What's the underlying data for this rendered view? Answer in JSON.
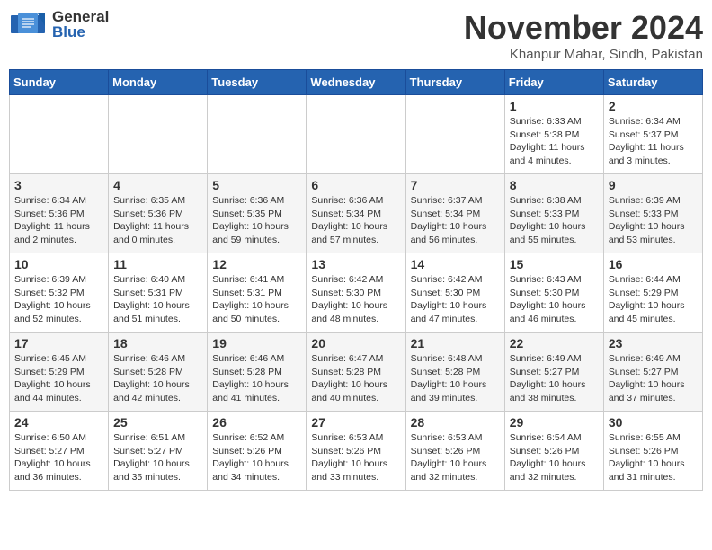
{
  "header": {
    "logo_general": "General",
    "logo_blue": "Blue",
    "month_title": "November 2024",
    "location": "Khanpur Mahar, Sindh, Pakistan"
  },
  "days_of_week": [
    "Sunday",
    "Monday",
    "Tuesday",
    "Wednesday",
    "Thursday",
    "Friday",
    "Saturday"
  ],
  "weeks": [
    [
      {
        "day": "",
        "info": ""
      },
      {
        "day": "",
        "info": ""
      },
      {
        "day": "",
        "info": ""
      },
      {
        "day": "",
        "info": ""
      },
      {
        "day": "",
        "info": ""
      },
      {
        "day": "1",
        "info": "Sunrise: 6:33 AM\nSunset: 5:38 PM\nDaylight: 11 hours and 4 minutes."
      },
      {
        "day": "2",
        "info": "Sunrise: 6:34 AM\nSunset: 5:37 PM\nDaylight: 11 hours and 3 minutes."
      }
    ],
    [
      {
        "day": "3",
        "info": "Sunrise: 6:34 AM\nSunset: 5:36 PM\nDaylight: 11 hours and 2 minutes."
      },
      {
        "day": "4",
        "info": "Sunrise: 6:35 AM\nSunset: 5:36 PM\nDaylight: 11 hours and 0 minutes."
      },
      {
        "day": "5",
        "info": "Sunrise: 6:36 AM\nSunset: 5:35 PM\nDaylight: 10 hours and 59 minutes."
      },
      {
        "day": "6",
        "info": "Sunrise: 6:36 AM\nSunset: 5:34 PM\nDaylight: 10 hours and 57 minutes."
      },
      {
        "day": "7",
        "info": "Sunrise: 6:37 AM\nSunset: 5:34 PM\nDaylight: 10 hours and 56 minutes."
      },
      {
        "day": "8",
        "info": "Sunrise: 6:38 AM\nSunset: 5:33 PM\nDaylight: 10 hours and 55 minutes."
      },
      {
        "day": "9",
        "info": "Sunrise: 6:39 AM\nSunset: 5:33 PM\nDaylight: 10 hours and 53 minutes."
      }
    ],
    [
      {
        "day": "10",
        "info": "Sunrise: 6:39 AM\nSunset: 5:32 PM\nDaylight: 10 hours and 52 minutes."
      },
      {
        "day": "11",
        "info": "Sunrise: 6:40 AM\nSunset: 5:31 PM\nDaylight: 10 hours and 51 minutes."
      },
      {
        "day": "12",
        "info": "Sunrise: 6:41 AM\nSunset: 5:31 PM\nDaylight: 10 hours and 50 minutes."
      },
      {
        "day": "13",
        "info": "Sunrise: 6:42 AM\nSunset: 5:30 PM\nDaylight: 10 hours and 48 minutes."
      },
      {
        "day": "14",
        "info": "Sunrise: 6:42 AM\nSunset: 5:30 PM\nDaylight: 10 hours and 47 minutes."
      },
      {
        "day": "15",
        "info": "Sunrise: 6:43 AM\nSunset: 5:30 PM\nDaylight: 10 hours and 46 minutes."
      },
      {
        "day": "16",
        "info": "Sunrise: 6:44 AM\nSunset: 5:29 PM\nDaylight: 10 hours and 45 minutes."
      }
    ],
    [
      {
        "day": "17",
        "info": "Sunrise: 6:45 AM\nSunset: 5:29 PM\nDaylight: 10 hours and 44 minutes."
      },
      {
        "day": "18",
        "info": "Sunrise: 6:46 AM\nSunset: 5:28 PM\nDaylight: 10 hours and 42 minutes."
      },
      {
        "day": "19",
        "info": "Sunrise: 6:46 AM\nSunset: 5:28 PM\nDaylight: 10 hours and 41 minutes."
      },
      {
        "day": "20",
        "info": "Sunrise: 6:47 AM\nSunset: 5:28 PM\nDaylight: 10 hours and 40 minutes."
      },
      {
        "day": "21",
        "info": "Sunrise: 6:48 AM\nSunset: 5:28 PM\nDaylight: 10 hours and 39 minutes."
      },
      {
        "day": "22",
        "info": "Sunrise: 6:49 AM\nSunset: 5:27 PM\nDaylight: 10 hours and 38 minutes."
      },
      {
        "day": "23",
        "info": "Sunrise: 6:49 AM\nSunset: 5:27 PM\nDaylight: 10 hours and 37 minutes."
      }
    ],
    [
      {
        "day": "24",
        "info": "Sunrise: 6:50 AM\nSunset: 5:27 PM\nDaylight: 10 hours and 36 minutes."
      },
      {
        "day": "25",
        "info": "Sunrise: 6:51 AM\nSunset: 5:27 PM\nDaylight: 10 hours and 35 minutes."
      },
      {
        "day": "26",
        "info": "Sunrise: 6:52 AM\nSunset: 5:26 PM\nDaylight: 10 hours and 34 minutes."
      },
      {
        "day": "27",
        "info": "Sunrise: 6:53 AM\nSunset: 5:26 PM\nDaylight: 10 hours and 33 minutes."
      },
      {
        "day": "28",
        "info": "Sunrise: 6:53 AM\nSunset: 5:26 PM\nDaylight: 10 hours and 32 minutes."
      },
      {
        "day": "29",
        "info": "Sunrise: 6:54 AM\nSunset: 5:26 PM\nDaylight: 10 hours and 32 minutes."
      },
      {
        "day": "30",
        "info": "Sunrise: 6:55 AM\nSunset: 5:26 PM\nDaylight: 10 hours and 31 minutes."
      }
    ]
  ]
}
